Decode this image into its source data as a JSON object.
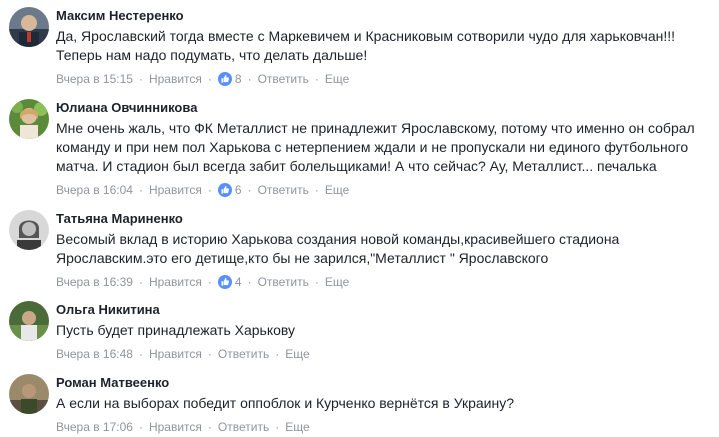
{
  "comments": [
    {
      "author": "Максим Нестеренко",
      "lines": [
        "Да, Ярославский тогда вместе с Маркевичем и Красниковым сотворили чудо для харьковчан!!!",
        "Теперь нам надо подумать, что делать дальше!"
      ],
      "time": "Вчера в 15:15",
      "like_label": "Нравится",
      "likes": "8",
      "reply_label": "Ответить",
      "more_label": "Еще"
    },
    {
      "author": "Юлиана Овчинникова",
      "lines": [
        "Мне очень жаль, что ФК Металлист не принадлежит Ярославскому, потому что именно он собрал",
        "команду и при нем пол Харькова с нетерпением ждали и не пропускали ни единого футбольного",
        "матча. И стадион был всегда забит болельщиками! А что сейчас? Ау, Металлист... печалька"
      ],
      "time": "Вчера в 16:04",
      "like_label": "Нравится",
      "likes": "6",
      "reply_label": "Ответить",
      "more_label": "Еще"
    },
    {
      "author": "Татьяна Мариненко",
      "lines": [
        "Весомый вклад в историю Харькова создания новой команды,красивейшего стадиона",
        "Ярославским.это его детище,кто бы не зарился,\"Металлист \" Ярославского"
      ],
      "time": "Вчера в 16:39",
      "like_label": "Нравится",
      "likes": "4",
      "reply_label": "Ответить",
      "more_label": "Еще"
    },
    {
      "author": "Ольга Никитина",
      "lines": [
        "Пусть будет принадлежать Харькову"
      ],
      "time": "Вчера в 16:48",
      "like_label": "Нравится",
      "reply_label": "Ответить",
      "more_label": "Еще"
    },
    {
      "author": "Роман Матвеенко",
      "lines": [
        "А если на выборах победит оппоблок и Курченко вернётся в Украину?"
      ],
      "time": "Вчера в 17:06",
      "like_label": "Нравится",
      "reply_label": "Ответить",
      "more_label": "Еще"
    }
  ],
  "colors": {
    "text": "#1d2129",
    "meta": "#90949c",
    "like_badge": "#5890ff"
  },
  "icons": {
    "like": "thumbs-up-icon",
    "separator": "·"
  }
}
